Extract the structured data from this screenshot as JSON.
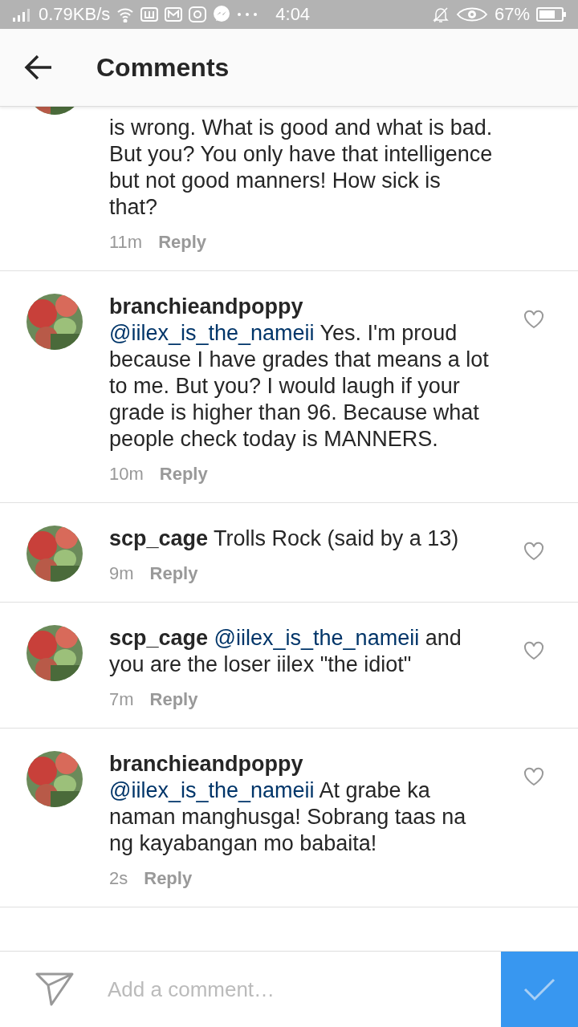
{
  "status_bar": {
    "speed": "0.79KB/s",
    "time": "4:04",
    "battery": "67%"
  },
  "header": {
    "title": "Comments"
  },
  "comments": [
    {
      "kind": "cut",
      "text": "is wrong. What is good and what is bad. But you? You only have that intelligence but not good manners! How sick is that?",
      "time": "11m",
      "reply": "Reply"
    },
    {
      "kind": "full",
      "username": "branchieandpoppy",
      "mention": "@iilex_is_the_nameii",
      "text": "Yes. I'm proud because I have grades that means a lot to me. But you? I would laugh if your grade is higher than 96. Because what people check today is MANNERS.",
      "time": "10m",
      "reply": "Reply"
    },
    {
      "kind": "full",
      "username": "scp_cage",
      "text": "Trolls Rock (said by a 13)",
      "time": "9m",
      "reply": "Reply"
    },
    {
      "kind": "full",
      "username": "scp_cage",
      "mention": "@iilex_is_the_nameii",
      "text": "and you are the loser iilex \"the idiot\"",
      "time": "7m",
      "reply": "Reply"
    },
    {
      "kind": "full",
      "username": "branchieandpoppy",
      "mention": "@iilex_is_the_nameii",
      "text": "At grabe ka naman manghusga! Sobrang taas na ng kayabangan mo babaita!",
      "time": "2s",
      "reply": "Reply"
    }
  ],
  "composer": {
    "placeholder": "Add a comment…"
  }
}
